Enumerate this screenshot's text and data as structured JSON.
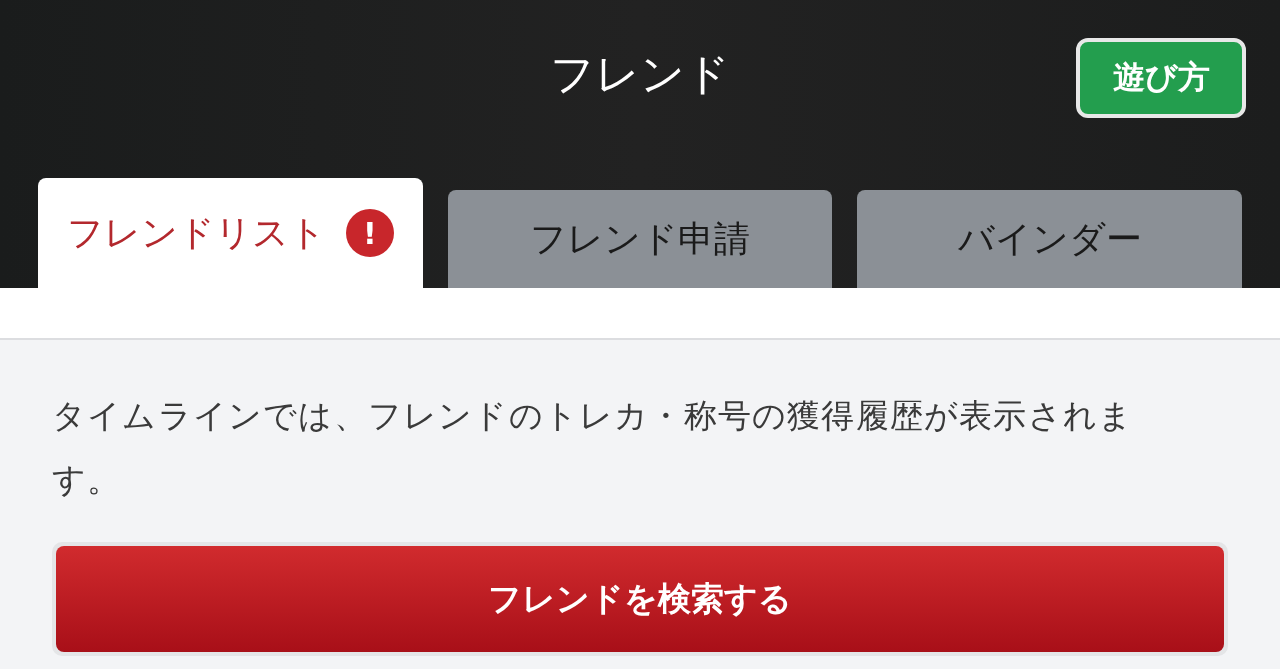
{
  "header": {
    "title": "フレンド",
    "help_button": "遊び方"
  },
  "tabs": [
    {
      "label": "フレンドリスト",
      "selected": true,
      "badge": "!"
    },
    {
      "label": "フレンド申請",
      "selected": false
    },
    {
      "label": "バインダー",
      "selected": false
    }
  ],
  "notice": "タイムラインでは、フレンドのトレカ・称号の獲得履歴が表示されます。",
  "search_button": "フレンドを検索する"
}
